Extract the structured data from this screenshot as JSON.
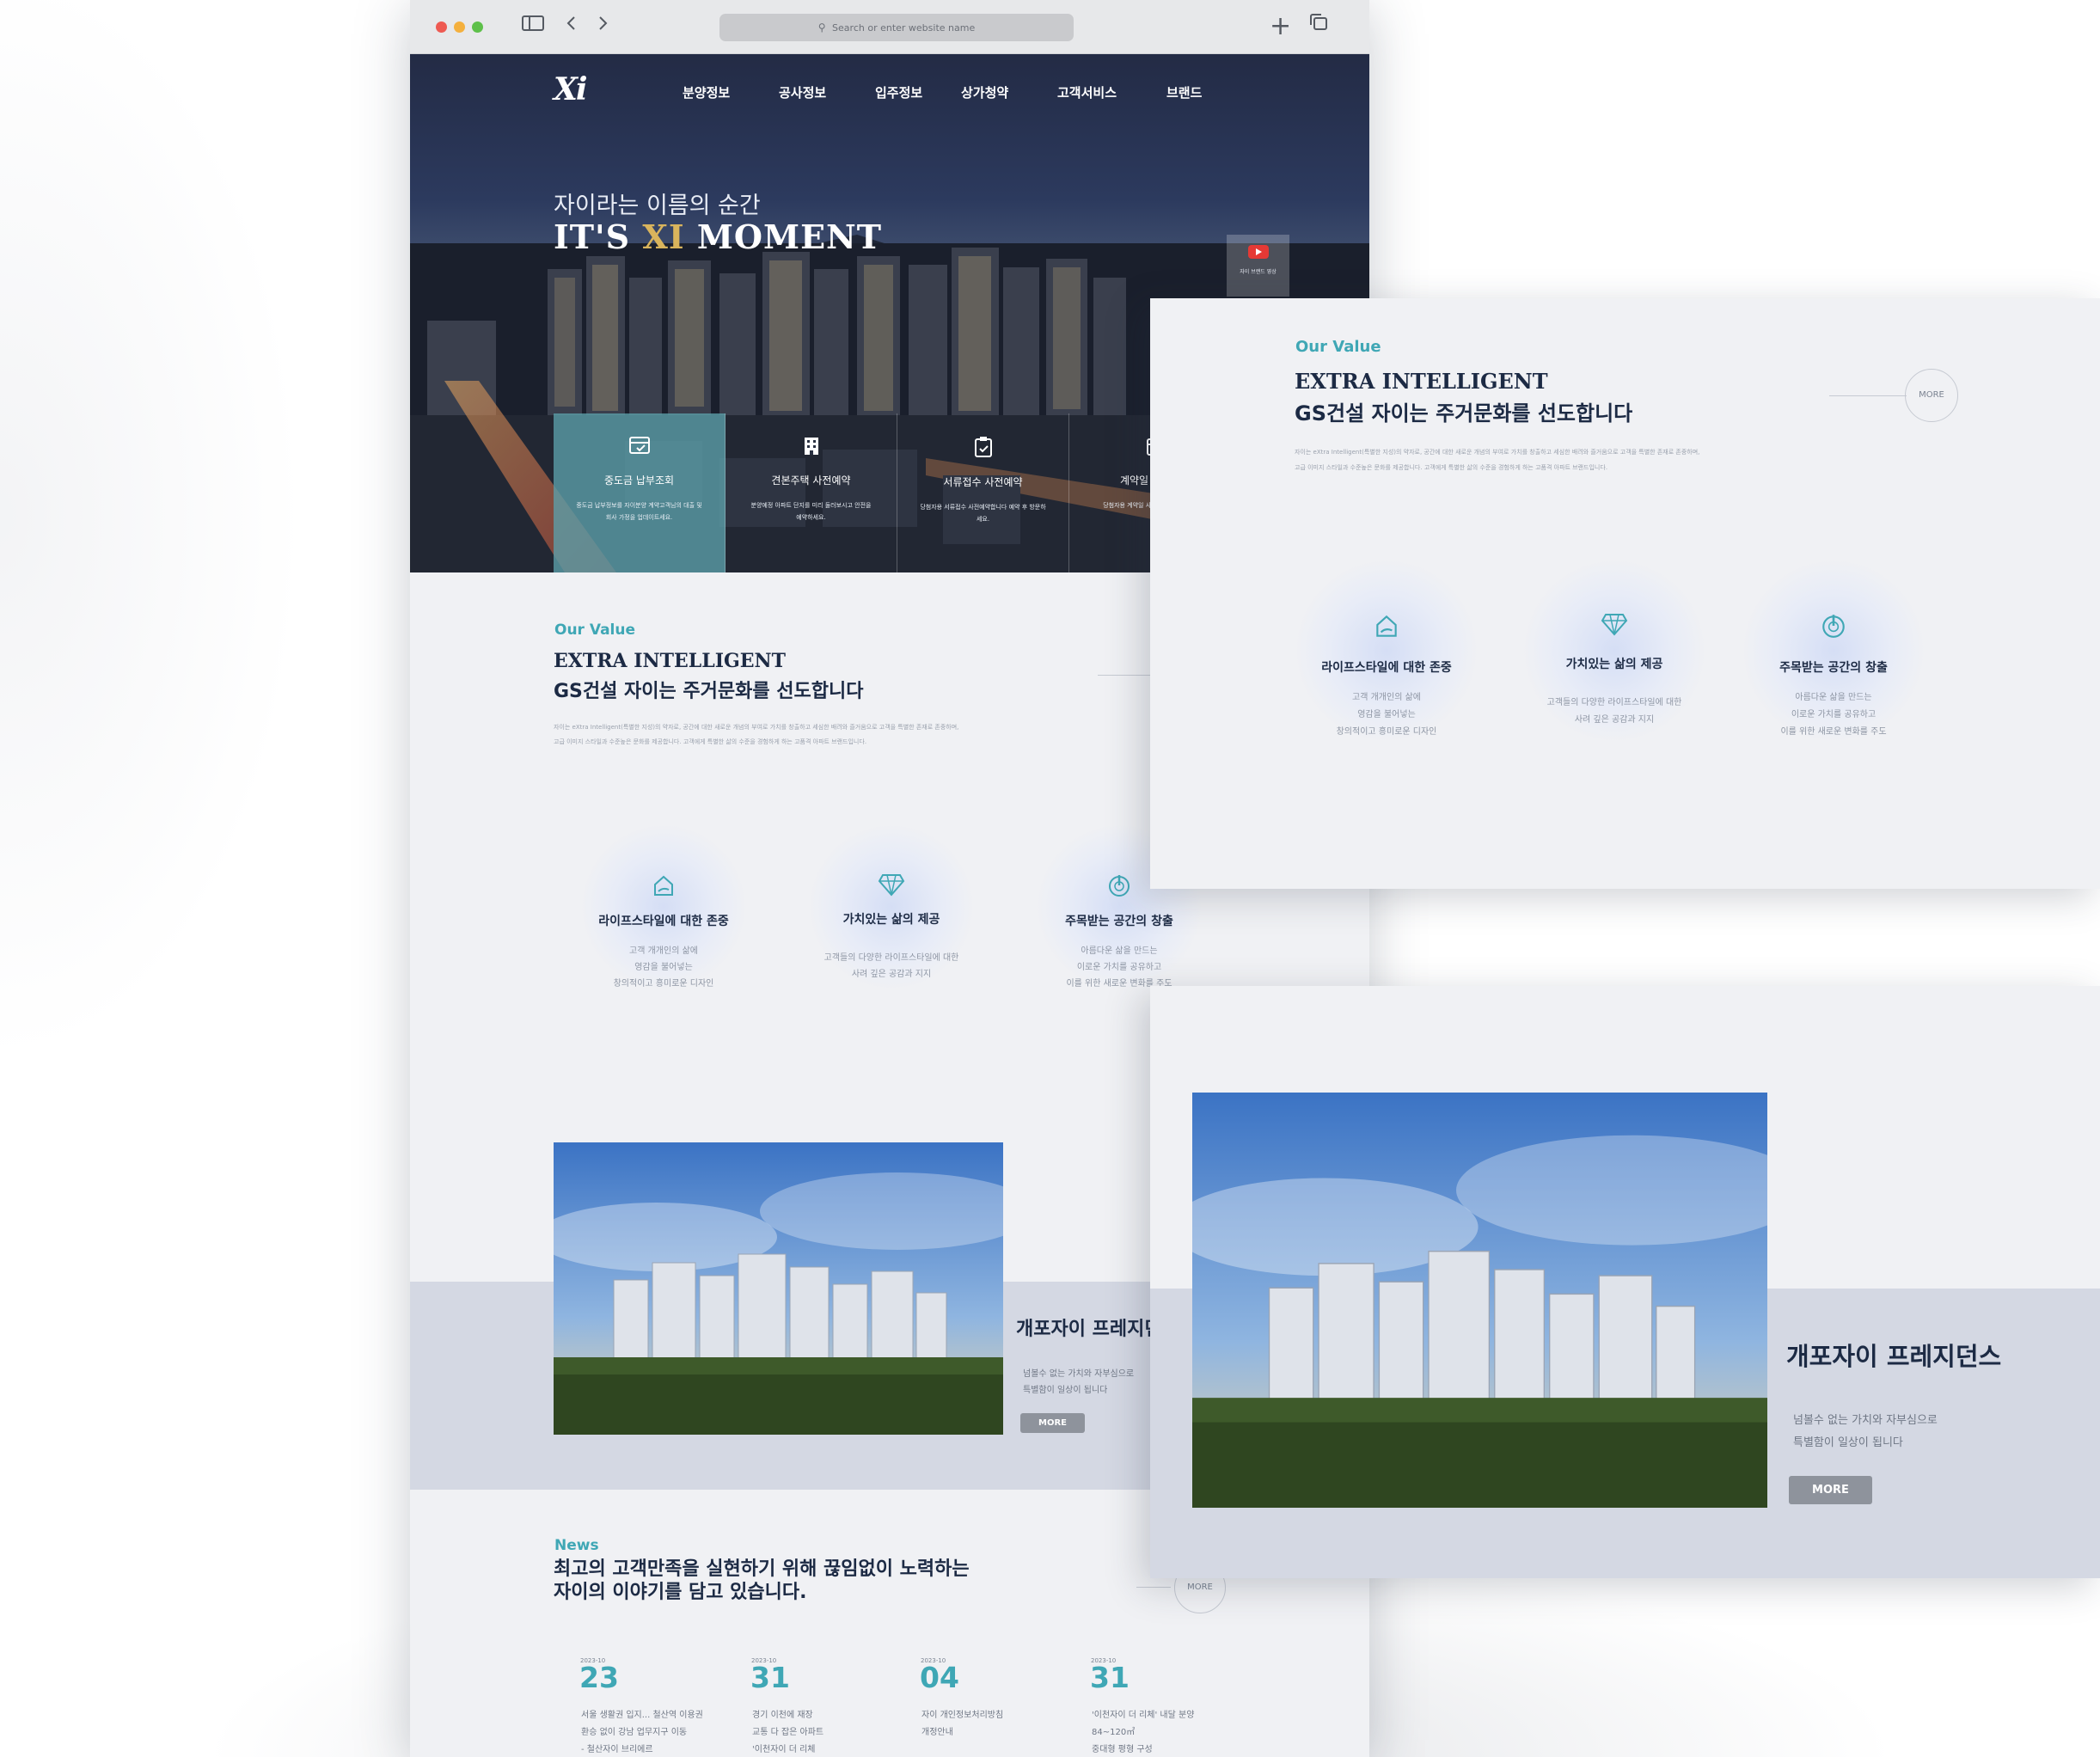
{
  "browser": {
    "url_placeholder": "Search or enter website name",
    "new_tab_icon": "plus-icon",
    "tabs_icon": "tabs-icon",
    "sidebar_icon": "sidebar-icon"
  },
  "site": {
    "logo": "Xi",
    "nav": [
      "분양정보",
      "공사정보",
      "입주정보",
      "상가청약",
      "고객서비스",
      "브랜드"
    ]
  },
  "hero": {
    "subtitle": "자이라는 이름의 순간",
    "title_pre": "IT'S ",
    "title_xi": "XI",
    "title_post": " MOMENT",
    "video_label": "자이 브랜드 영상",
    "quick_links": [
      {
        "icon": "payment-check-icon",
        "title": "중도금 납부조회",
        "desc": "중도금 납부정보를 자이분양 계약고객님의 대출 및 회사 가정을 업데이트세요."
      },
      {
        "icon": "building-icon",
        "title": "견본주택 사전예약",
        "desc": "분양예정 아파트 단지를 미리 둘러보시고 안전을 예약하세요."
      },
      {
        "icon": "document-check-icon",
        "title": "서류접수 사전예약",
        "desc": "당첨자용 서류접수 사전예약합니다 예약 후 방문하세요."
      },
      {
        "icon": "calendar-icon",
        "title": "계약일 사전예약",
        "desc": "당첨자용 계약일 사전예약 후 방문하세요."
      }
    ]
  },
  "value": {
    "label": "Our Value",
    "title_en": "EXTRA  INTELLIGENT",
    "title_ko": "GS건설 자이는 주거문화를 선도합니다",
    "desc_line1": "자이는 eXtra Intelligent(특별한 지성)의 약자로, 공간에 대한 새로운 개념의 부여로 가치를 창출하고 세심한 배려와 즐거움으로 고객을 특별한 존재로 존중하며,",
    "desc_line2": "고급 이미지 스타일과 수준높은 문화를 제공합니다. 고객에게 특별한 삶의 수준을 경험하게 하는 고품격 아파트 브랜드입니다.",
    "more": "MORE",
    "items": [
      {
        "icon": "home-hand-icon",
        "title": "라이프스타일에 대한 존중",
        "lines": [
          "고객 개개인의 삶에",
          "영감을 불어넣는",
          "창의적이고 흥미로운 디자인"
        ]
      },
      {
        "icon": "diamond-icon",
        "title": "가치있는 삶의 제공",
        "lines": [
          "고객들의 다양한 라이프스타일에 대한",
          "사려 깊은 공감과 지지"
        ]
      },
      {
        "icon": "power-icon",
        "title": "주목받는 공간의 창출",
        "lines": [
          "아름다운 삶을 만드는",
          "이로운 가치를 공유하고",
          "이를 위한 새로운 변화를 주도"
        ]
      }
    ]
  },
  "product": {
    "title": "개포자이 프레지던스",
    "desc_line1": "넘볼수 없는 가치와 자부심으로",
    "desc_line2": "특별함이 일상이 됩니다",
    "more": "MORE"
  },
  "news": {
    "label": "News",
    "title_line1": "최고의 고객만족을 실현하기 위해 끊임없이 노력하는",
    "title_line2": "자이의 이야기를 담고 있습니다.",
    "more": "MORE",
    "items": [
      {
        "ym": "2023-10",
        "day": "23",
        "lines": [
          "서울 생활권 입지... 철산역 이용권",
          "환승 없이 강남 업무지구 이동",
          "- 철산자이 브리에르"
        ]
      },
      {
        "ym": "2023-10",
        "day": "31",
        "lines": [
          "경기 이천에 재장",
          "교통 다 잡은 아파트",
          "'이천자이 더 리체"
        ]
      },
      {
        "ym": "2023-10",
        "day": "04",
        "lines": [
          "자이 개인정보처리방침",
          "개정안내"
        ]
      },
      {
        "ym": "2023-10",
        "day": "31",
        "lines": [
          "'이천자이 더 리체' 내달 분양",
          "84~120㎡",
          "중대형 평형 구성"
        ]
      }
    ]
  },
  "colors": {
    "accent": "#3fa7b5",
    "navy": "#1c2a44",
    "band": "#d4d8e3",
    "page_bg": "#f0f1f4"
  }
}
